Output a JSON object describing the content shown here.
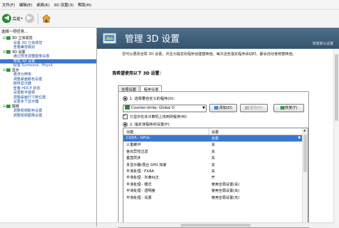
{
  "menu": [
    "文件(F)",
    "编辑(E)",
    "桌面(K)",
    "3D 设置(3)",
    "帮助(H)"
  ],
  "toolbar": {
    "back_label": "后退",
    "dropdown": "▾"
  },
  "sidebar": {
    "task_header": "选择一项任务...",
    "tree": [
      {
        "type": "cat",
        "label": "3D 立体视觉"
      },
      {
        "type": "leaf",
        "label": "设置 3D 立体视觉"
      },
      {
        "type": "leaf",
        "label": "查看兼容级别"
      },
      {
        "type": "cat",
        "label": "3D 设置"
      },
      {
        "type": "leaf",
        "label": "通过预览调整图像设置"
      },
      {
        "type": "leaf",
        "label": "管理 3D 设置",
        "selected": true
      },
      {
        "type": "leaf",
        "label": "配置 Surround、PhysX"
      },
      {
        "type": "cat",
        "label": "显示"
      },
      {
        "type": "leaf",
        "label": "更改分辨率"
      },
      {
        "type": "leaf",
        "label": "调整桌面颜色设置"
      },
      {
        "type": "leaf",
        "label": "旋转显示器"
      },
      {
        "type": "leaf",
        "label": "查看 HDCP 状态"
      },
      {
        "type": "leaf",
        "label": "设置数字音频"
      },
      {
        "type": "leaf",
        "label": "调整桌面尺寸和位置"
      },
      {
        "type": "leaf",
        "label": "设置多个显示器"
      },
      {
        "type": "cat",
        "label": "视频"
      },
      {
        "type": "leaf",
        "label": "调整视频颜色设置"
      },
      {
        "type": "leaf",
        "label": "调整视频图像设置"
      }
    ]
  },
  "banner": {
    "title": "管理 3D 设置",
    "restore": "恢复默认设置"
  },
  "description": "您可以更改全局 3D 设置，并且为指定的程序创建替换值。每次这些指定程序启动时，都会自动使用替换值。",
  "section_title": "我希望使用以下 3D 设置：",
  "tabs": [
    "全局设置",
    "程序设置"
  ],
  "program": {
    "select_label": "1. 选择要自定义的程序(O)：",
    "selected_program": "Counter-strike: Global O",
    "add_button": "添加(D)",
    "remove_button": "删除(R)",
    "restore_button": "恢复(T)",
    "show_only_label": "只显示在本计算机上找到的程序(W)",
    "settings_label": "2. 指定该程序的设置(P)："
  },
  "grid": {
    "col_feature": "功能",
    "col_setting": "设置",
    "rows": [
      {
        "feature": "CUDA - GPUs",
        "setting": "全部",
        "selected": true
      },
      {
        "feature": "三重缓冲",
        "setting": "关"
      },
      {
        "feature": "各向异性过滤",
        "setting": "关"
      },
      {
        "feature": "垂直同步",
        "setting": "关"
      },
      {
        "feature": "多显示器/混合 GPU 加速",
        "setting": "关"
      },
      {
        "feature": "平滑处理 - FXAA",
        "setting": "关"
      },
      {
        "feature": "平滑处理 - 灰度纠正",
        "setting": "开"
      },
      {
        "feature": "平滑处理 - 模式",
        "setting": "使用全局设置(关)"
      },
      {
        "feature": "平滑处理 - 透明度",
        "setting": "使用全局设置(关)"
      },
      {
        "feature": "平滑处理 - 设置",
        "setting": "使用全局设置(无)"
      }
    ]
  },
  "colors": {
    "accent": "#3b78d0",
    "banner": "#4d6f8b",
    "link": "#1a4fa0"
  },
  "icons": [
    "back-arrow-icon",
    "forward-arrow-icon",
    "home-icon",
    "nvidia-3d-icon",
    "program-icon"
  ]
}
